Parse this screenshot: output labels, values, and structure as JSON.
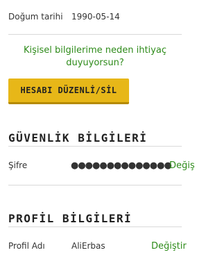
{
  "personal": {
    "birth_label": "Doğum tarihi",
    "birth_value": "1990-05-14",
    "why_text": "Kişisel bilgilerime neden ihtiyaç duyuyorsun?",
    "edit_delete_button": "HESABI DÜZENLİ/SİL"
  },
  "security": {
    "title": "GÜVENLİK BİLGİLERİ",
    "password_label": "Şifre",
    "password_mask": "●●●●●●●●●●●●●●",
    "change_label": "Değiş"
  },
  "profile": {
    "title": "PROFİL BİLGİLERİ",
    "name_label": "Profil Adı",
    "name_value": "AliErbas",
    "change_label": "Değiştir"
  },
  "colors": {
    "accent_green": "#2e8b1a",
    "button_yellow": "#e7b718"
  }
}
